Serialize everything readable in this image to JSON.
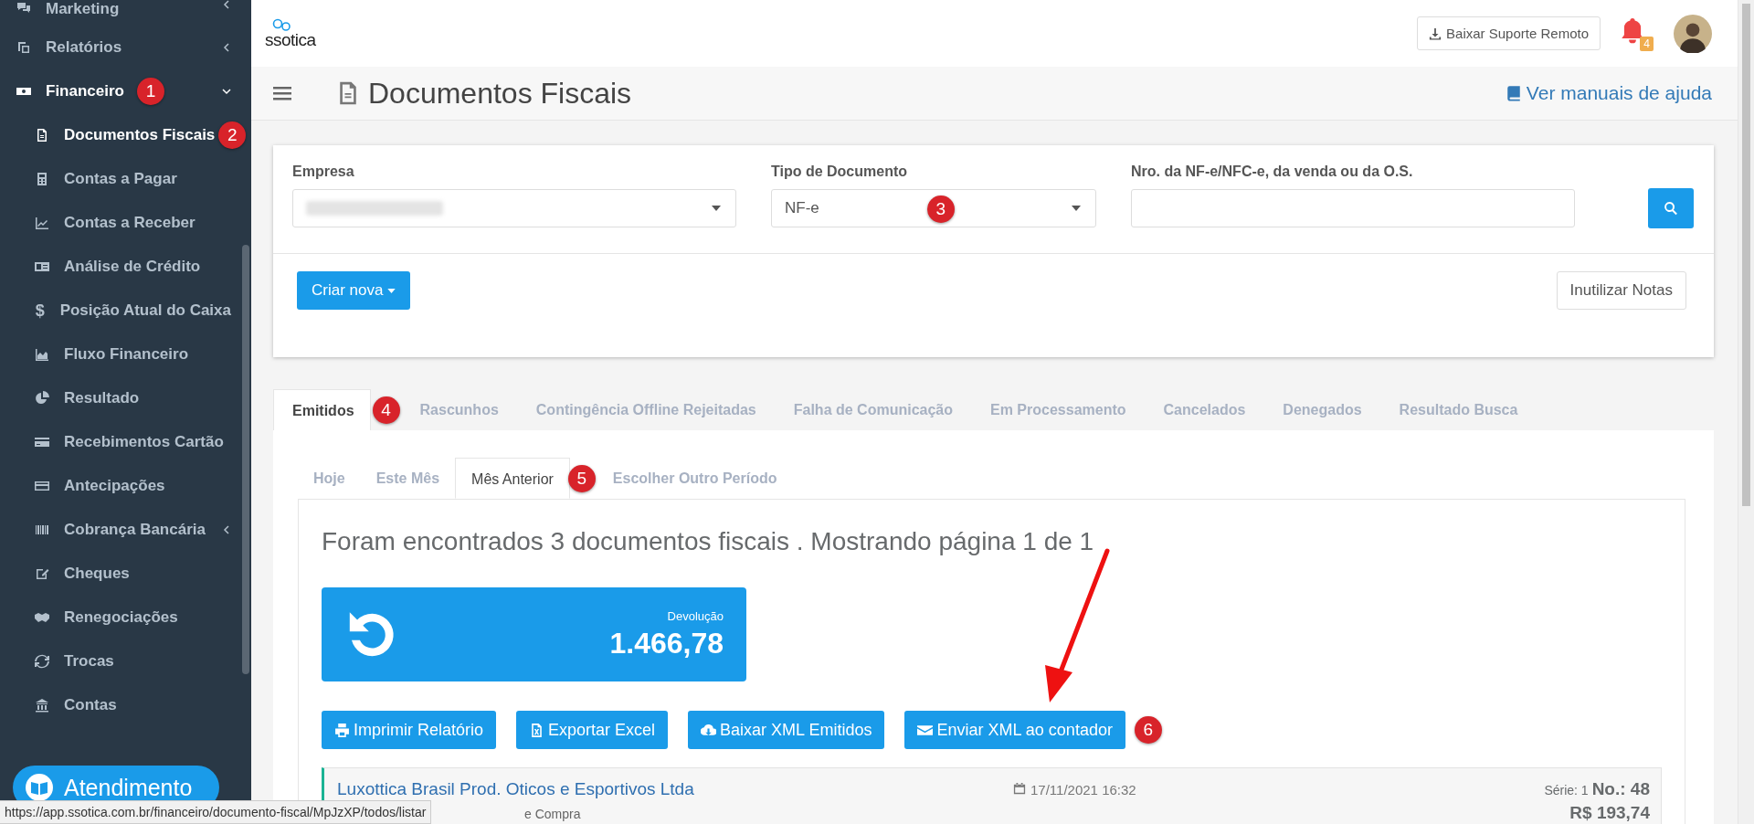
{
  "sidebar": {
    "items": [
      {
        "label": "Marketing",
        "expandable": true,
        "expanded": false
      },
      {
        "label": "Relatórios",
        "expandable": true,
        "expanded": false
      },
      {
        "label": "Financeiro",
        "expandable": true,
        "expanded": true,
        "marker": "1",
        "children": [
          {
            "label": "Documentos Fiscais",
            "selected": true,
            "marker": "2"
          },
          {
            "label": "Contas a Pagar",
            "selected": false
          },
          {
            "label": "Contas a Receber",
            "selected": false
          },
          {
            "label": "Análise de Crédito",
            "selected": false
          },
          {
            "label": "Posição Atual do Caixa",
            "glyph": "$",
            "selected": false
          },
          {
            "label": "Fluxo Financeiro",
            "selected": false
          },
          {
            "label": "Resultado",
            "selected": false
          },
          {
            "label": "Recebimentos Cartão",
            "selected": false
          },
          {
            "label": "Antecipações",
            "selected": false
          },
          {
            "label": "Cobrança Bancária",
            "selected": false,
            "expandable": true
          },
          {
            "label": "Cheques",
            "selected": false
          },
          {
            "label": "Renegociações",
            "selected": false
          },
          {
            "label": "Trocas",
            "selected": false
          },
          {
            "label": "Contas",
            "selected": false
          }
        ]
      }
    ]
  },
  "support_button": {
    "label": "Atendimento"
  },
  "status_bar": {
    "url": "https://app.ssotica.com.br/financeiro/documento-fiscal/MpJzXP/todos/listar"
  },
  "header": {
    "logo": "ssotica",
    "remote_button": "Baixar Suporte Remoto",
    "notification_count": "4"
  },
  "page": {
    "title": "Documentos Fiscais",
    "help_link": "Ver manuais de ajuda"
  },
  "filters": {
    "fields": [
      {
        "label": "Empresa",
        "kind": "select",
        "value_hidden": true
      },
      {
        "label": "Tipo de Documento",
        "kind": "select",
        "value": "NF-e",
        "marker": "3"
      },
      {
        "label": "Nro. da NF-e/NFC-e, da venda ou da O.S.",
        "kind": "text"
      }
    ],
    "create_button": "Criar nova",
    "void_button": "Inutilizar Notas"
  },
  "tabs": [
    {
      "label": "Emitidos",
      "selected": true,
      "marker": "4"
    },
    {
      "label": "Rascunhos",
      "selected": false
    },
    {
      "label": "Contingência Offline Rejeitadas",
      "selected": false
    },
    {
      "label": "Falha de Comunicação",
      "selected": false
    },
    {
      "label": "Em Processamento",
      "selected": false
    },
    {
      "label": "Cancelados",
      "selected": false
    },
    {
      "label": "Denegados",
      "selected": false
    },
    {
      "label": "Resultado Busca",
      "selected": false
    }
  ],
  "period_tabs": [
    {
      "label": "Hoje",
      "selected": false
    },
    {
      "label": "Este Mês",
      "selected": false
    },
    {
      "label": "Mês Anterior",
      "selected": true,
      "marker": "5"
    },
    {
      "label": "Escolher Outro Período",
      "selected": false
    }
  ],
  "results": {
    "summary": "Foram encontrados 3 documentos fiscais . Mostrando página 1 de 1",
    "stat_card": {
      "label": "Devolução",
      "value": "1.466,78"
    },
    "actions": [
      {
        "label": "Imprimir Relatório"
      },
      {
        "label": "Exportar Excel"
      },
      {
        "label": "Baixar XML Emitidos"
      },
      {
        "label": "Enviar XML ao contador",
        "marker": "6"
      }
    ],
    "documents": [
      {
        "company": "Luxottica Brasil Prod. Oticos e Esportivos Ltda",
        "type": "e Compra",
        "date": "17/11/2021 16:32",
        "series_label": "Série:",
        "series": "1",
        "number_label": "No.:",
        "number": "48",
        "amount": "R$ 193,74"
      }
    ]
  }
}
